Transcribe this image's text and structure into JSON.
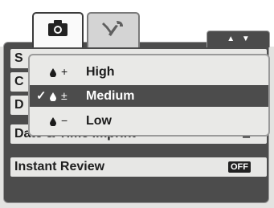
{
  "tabs": [
    {
      "name": "camera-tab",
      "icon": "camera-icon",
      "active": true
    },
    {
      "name": "setup-tab",
      "icon": "wrench-icon",
      "active": false
    }
  ],
  "page_arrows": {
    "up": "▲",
    "down": "▼"
  },
  "menu_items": [
    {
      "label": "S"
    },
    {
      "label": "C"
    },
    {
      "label": "D"
    },
    {
      "label": "Date & Time Imprint",
      "value": "⊡"
    },
    {
      "label": "Instant Review",
      "value": "OFF"
    }
  ],
  "popup": {
    "options": [
      {
        "icon": "drop-icon",
        "sign": "+",
        "label": "High",
        "selected": false
      },
      {
        "icon": "drop-icon",
        "sign": "±",
        "label": "Medium",
        "selected": true,
        "check": "✓"
      },
      {
        "icon": "drop-icon",
        "sign": "−",
        "label": "Low",
        "selected": false
      }
    ]
  },
  "colors": {
    "panel": "#4c4c4c",
    "row": "#e7e7e5",
    "highlight": "#4c4c4c",
    "background": "#e3e3e1"
  }
}
